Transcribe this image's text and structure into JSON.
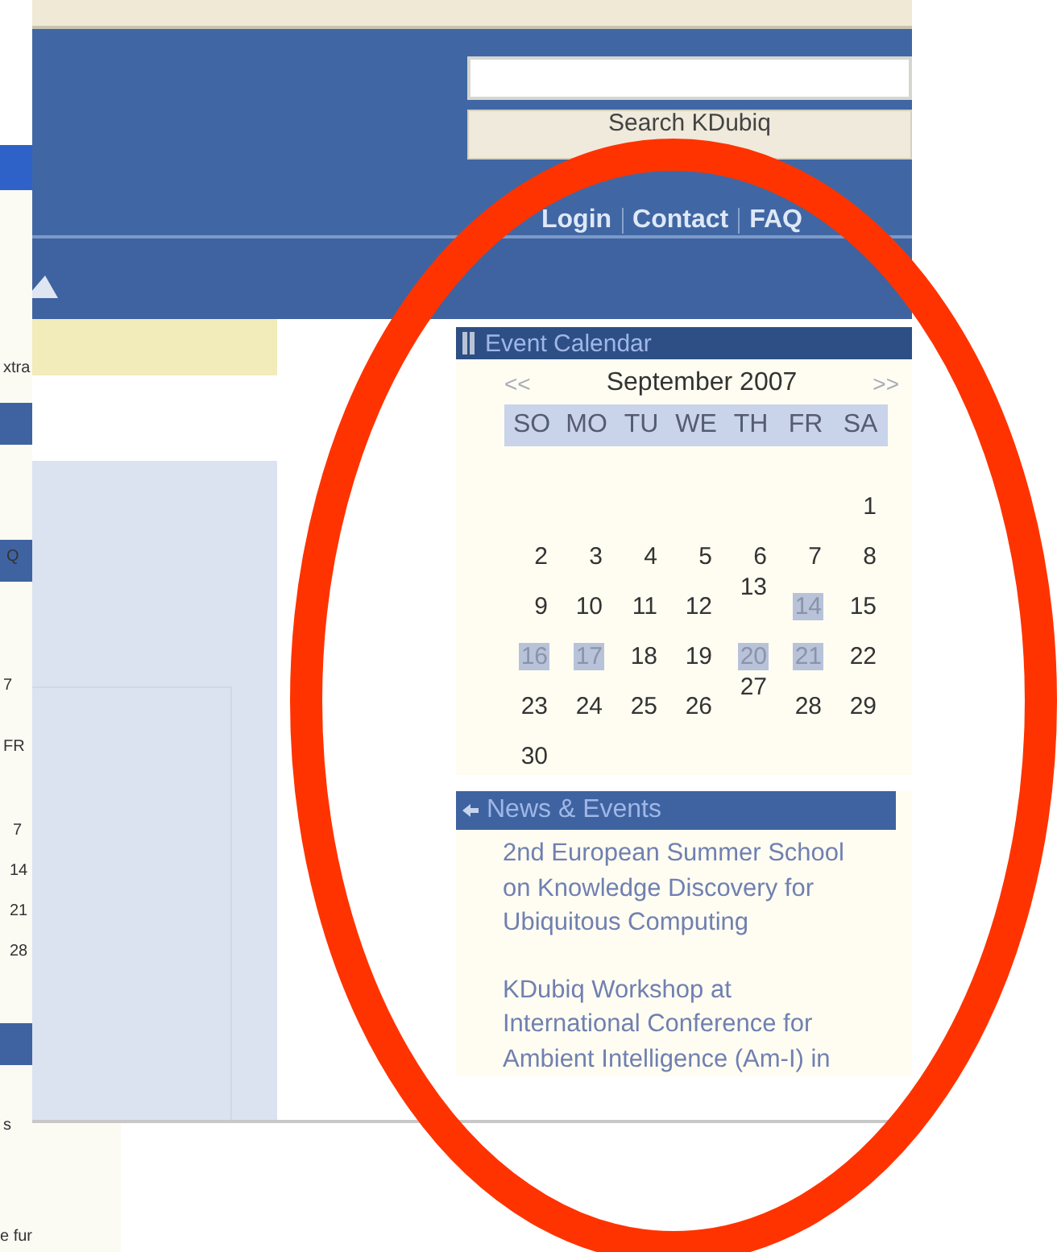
{
  "background_window": {
    "texts": [
      "xtra",
      "Q",
      "7",
      "FR",
      "7",
      "14",
      "21",
      "28",
      "s",
      "e fur"
    ]
  },
  "header": {
    "search": {
      "button": "Search KDubiq"
    },
    "links": [
      {
        "label": "Login"
      },
      {
        "label": "Contact"
      },
      {
        "label": "FAQ"
      }
    ]
  },
  "event_calendar": {
    "title": "Event Calendar",
    "prev": "<<",
    "month": "September",
    "year": "2007",
    "next": ">>",
    "weekdays": [
      "SO",
      "MO",
      "TU",
      "WE",
      "TH",
      "FR",
      "SA"
    ],
    "weeks": [
      {
        "kind": "padded",
        "days": [
          {
            "day": "1",
            "highlighted": false,
            "raised": false
          }
        ]
      },
      {
        "kind": "normal",
        "days": [
          {
            "day": "2",
            "highlighted": false,
            "raised": false
          },
          {
            "day": "3",
            "highlighted": false,
            "raised": false
          },
          {
            "day": "4",
            "highlighted": false,
            "raised": false
          },
          {
            "day": "5",
            "highlighted": false,
            "raised": false
          },
          {
            "day": "6",
            "highlighted": false,
            "raised": false
          },
          {
            "day": "7",
            "highlighted": false,
            "raised": false
          },
          {
            "day": "8",
            "highlighted": false,
            "raised": false
          }
        ]
      },
      {
        "kind": "normal",
        "days": [
          {
            "day": "9",
            "highlighted": false,
            "raised": false
          },
          {
            "day": "10",
            "highlighted": false,
            "raised": false
          },
          {
            "day": "11",
            "highlighted": false,
            "raised": false
          },
          {
            "day": "12",
            "highlighted": false,
            "raised": false
          },
          {
            "day": "13",
            "highlighted": false,
            "raised": true
          },
          {
            "day": "14",
            "highlighted": true,
            "raised": false
          },
          {
            "day": "15",
            "highlighted": false,
            "raised": false
          }
        ]
      },
      {
        "kind": "normal",
        "days": [
          {
            "day": "16",
            "highlighted": true,
            "raised": false
          },
          {
            "day": "17",
            "highlighted": true,
            "raised": false
          },
          {
            "day": "18",
            "highlighted": false,
            "raised": false
          },
          {
            "day": "19",
            "highlighted": false,
            "raised": false
          },
          {
            "day": "20",
            "highlighted": true,
            "raised": false
          },
          {
            "day": "21",
            "highlighted": true,
            "raised": false
          },
          {
            "day": "22",
            "highlighted": false,
            "raised": false
          }
        ]
      },
      {
        "kind": "normal",
        "days": [
          {
            "day": "23",
            "highlighted": false,
            "raised": false
          },
          {
            "day": "24",
            "highlighted": false,
            "raised": false
          },
          {
            "day": "25",
            "highlighted": false,
            "raised": false
          },
          {
            "day": "26",
            "highlighted": false,
            "raised": false
          },
          {
            "day": "27",
            "highlighted": false,
            "raised": true
          },
          {
            "day": "28",
            "highlighted": false,
            "raised": false
          },
          {
            "day": "29",
            "highlighted": false,
            "raised": false
          }
        ]
      },
      {
        "kind": "normal",
        "days": [
          {
            "day": "30",
            "highlighted": false,
            "raised": false
          }
        ]
      }
    ]
  },
  "news": {
    "title": "News & Events",
    "items": [
      "2nd European Summer School on Knowledge Discovery for Ubiquitous Computing",
      "KDubiq Workshop at International Conference for Ambient Intelligence (Am-I) in"
    ]
  },
  "annotation": {
    "kind": "ellipse"
  }
}
